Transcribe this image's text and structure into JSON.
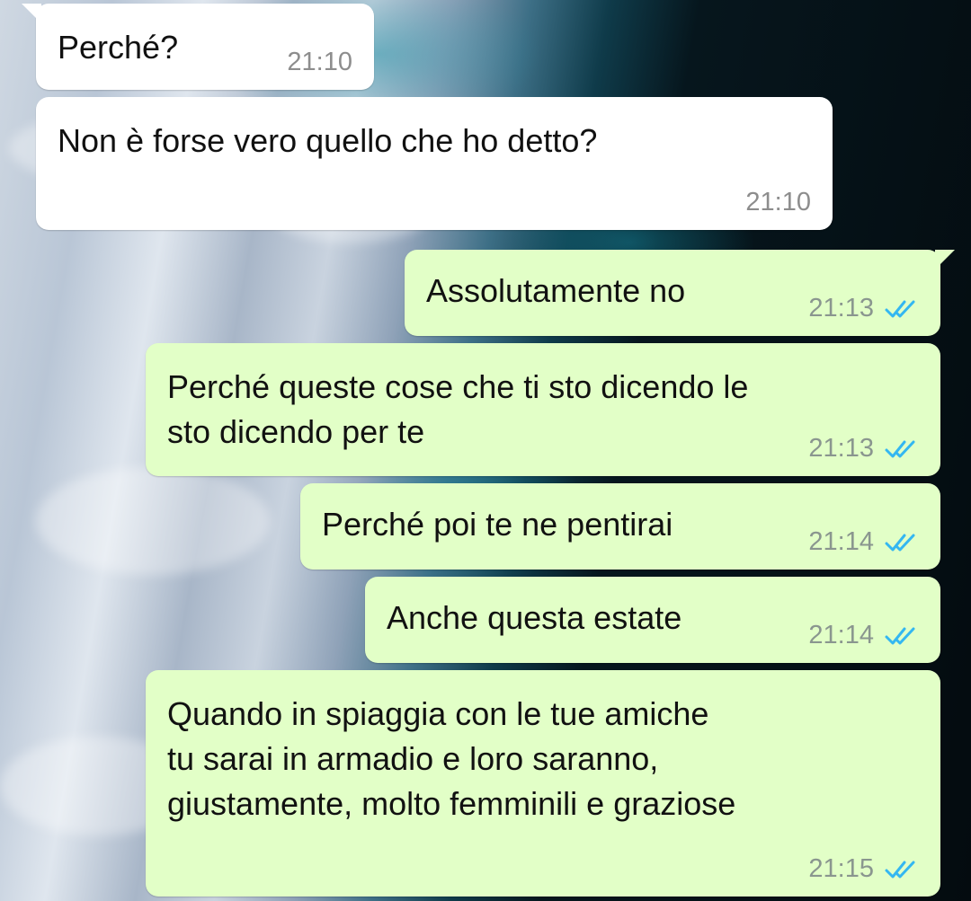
{
  "messages": [
    {
      "direction": "incoming",
      "text": "Perché?",
      "time": "21:10"
    },
    {
      "direction": "incoming",
      "text": "Non è forse vero quello che ho detto?",
      "time": "21:10"
    },
    {
      "direction": "outgoing",
      "text": "Assolutamente no",
      "time": "21:13",
      "status_icon": "double-check-read-icon"
    },
    {
      "direction": "outgoing",
      "text": "Perché queste cose che ti sto dicendo le\nsto dicendo per te",
      "time": "21:13",
      "status_icon": "double-check-read-icon"
    },
    {
      "direction": "outgoing",
      "text": "Perché poi te ne pentirai",
      "time": "21:14",
      "status_icon": "double-check-read-icon"
    },
    {
      "direction": "outgoing",
      "text": "Anche questa estate",
      "time": "21:14",
      "status_icon": "double-check-read-icon"
    },
    {
      "direction": "outgoing",
      "text": "Quando in spiaggia con le tue amiche\ntu sarai in armadio e loro saranno,\ngiustamente, molto femminili e graziose",
      "time": "21:15",
      "status_icon": "double-check-read-icon"
    }
  ],
  "colors": {
    "incoming_bubble": "#ffffff",
    "outgoing_bubble": "#e2ffc7",
    "read_ticks": "#34b7f1",
    "timestamp": "#8a968f"
  }
}
